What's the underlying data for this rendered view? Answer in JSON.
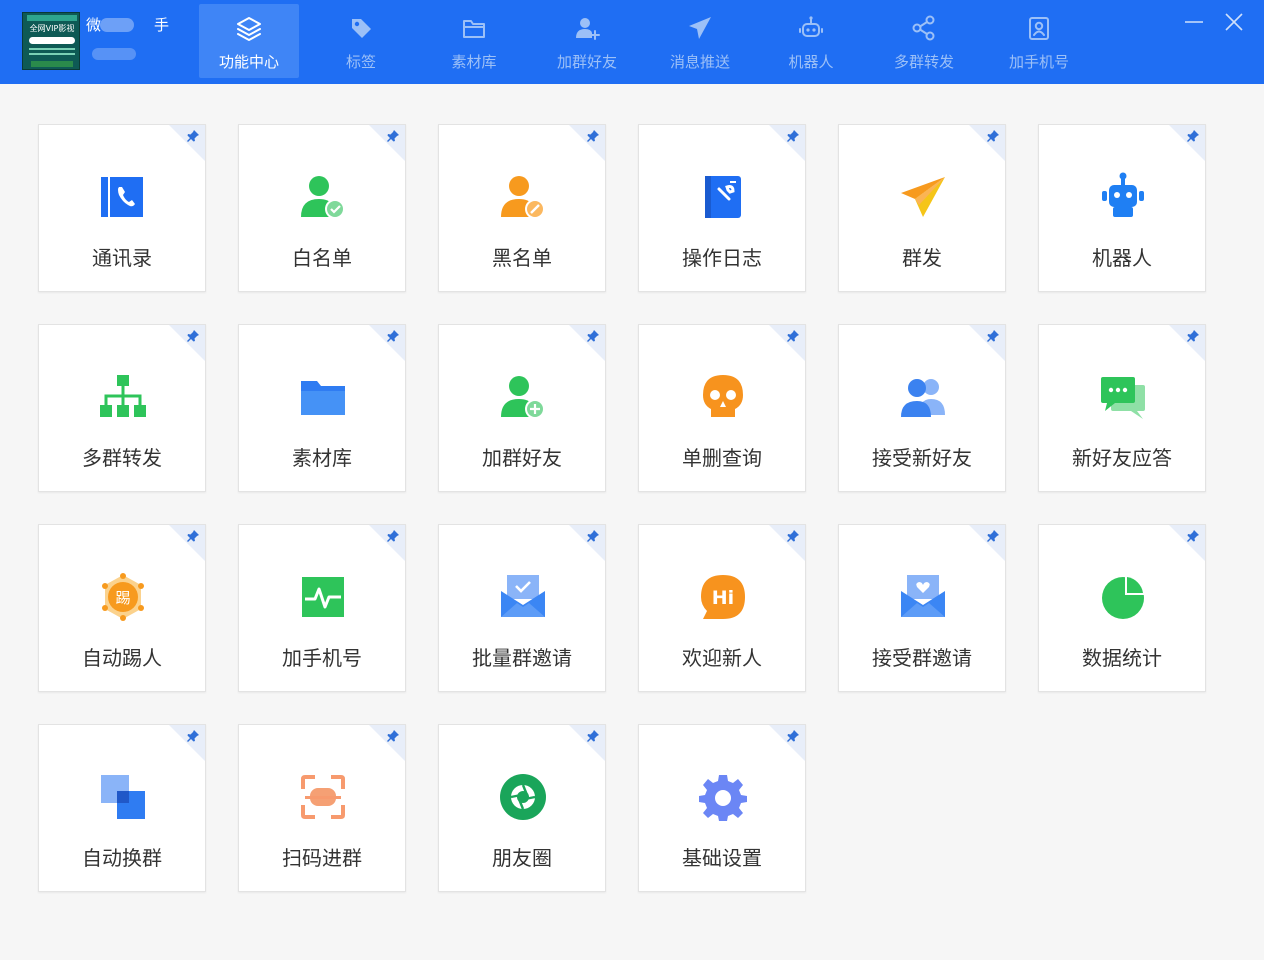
{
  "account": {
    "avatar_text": "全网VIP影视",
    "name_prefix": "微",
    "name_suffix": "手"
  },
  "nav": {
    "tabs": [
      {
        "label": "功能中心",
        "icon": "layers-icon",
        "active": true
      },
      {
        "label": "标签",
        "icon": "tag-icon",
        "active": false
      },
      {
        "label": "素材库",
        "icon": "folder-icon",
        "active": false
      },
      {
        "label": "加群好友",
        "icon": "add-user-icon",
        "active": false
      },
      {
        "label": "消息推送",
        "icon": "send-icon",
        "active": false
      },
      {
        "label": "机器人",
        "icon": "robot-icon",
        "active": false
      },
      {
        "label": "多群转发",
        "icon": "share-icon",
        "active": false
      },
      {
        "label": "加手机号",
        "icon": "contact-card-icon",
        "active": false
      }
    ]
  },
  "window": {
    "minimize_icon": "minimize-icon",
    "close_icon": "close-icon"
  },
  "cards": [
    {
      "label": "通讯录",
      "icon": "address-book-icon",
      "color": "#1f6ef3"
    },
    {
      "label": "白名单",
      "icon": "user-check-icon",
      "color": "#2ec45a"
    },
    {
      "label": "黑名单",
      "icon": "user-block-icon",
      "color": "#f79a1e"
    },
    {
      "label": "操作日志",
      "icon": "log-book-icon",
      "color": "#1f6ef3"
    },
    {
      "label": "群发",
      "icon": "paper-plane-icon",
      "color": "#f79a1e"
    },
    {
      "label": "机器人",
      "icon": "robot-icon",
      "color": "#1f7ff3"
    },
    {
      "label": "多群转发",
      "icon": "org-tree-icon",
      "color": "#2ec45a"
    },
    {
      "label": "素材库",
      "icon": "folder-icon",
      "color": "#4592f6"
    },
    {
      "label": "加群好友",
      "icon": "user-add-icon",
      "color": "#2ec45a"
    },
    {
      "label": "单删查询",
      "icon": "skull-icon",
      "color": "#f7931e"
    },
    {
      "label": "接受新好友",
      "icon": "users-icon",
      "color": "#3b82f0"
    },
    {
      "label": "新好友应答",
      "icon": "chat-bubbles-icon",
      "color": "#2ec45a"
    },
    {
      "label": "自动踢人",
      "icon": "kick-badge-icon",
      "color": "#f79a1e"
    },
    {
      "label": "加手机号",
      "icon": "pulse-monitor-icon",
      "color": "#2ec45a"
    },
    {
      "label": "批量群邀请",
      "icon": "mail-check-icon",
      "color": "#3b86f4"
    },
    {
      "label": "欢迎新人",
      "icon": "hi-bubble-icon",
      "color": "#f7931e"
    },
    {
      "label": "接受群邀请",
      "icon": "mail-heart-icon",
      "color": "#3b86f4"
    },
    {
      "label": "数据统计",
      "icon": "pie-chart-icon",
      "color": "#2ec45a"
    },
    {
      "label": "自动换群",
      "icon": "overlap-squares-icon",
      "color": "#2f7cf2"
    },
    {
      "label": "扫码进群",
      "icon": "scan-icon",
      "color": "#f79a6e"
    },
    {
      "label": "朋友圈",
      "icon": "camera-aperture-icon",
      "color": "#1aa55a"
    },
    {
      "label": "基础设置",
      "icon": "gear-icon",
      "color": "#6b86f5"
    }
  ],
  "avatar_label": "全网VIP影视"
}
